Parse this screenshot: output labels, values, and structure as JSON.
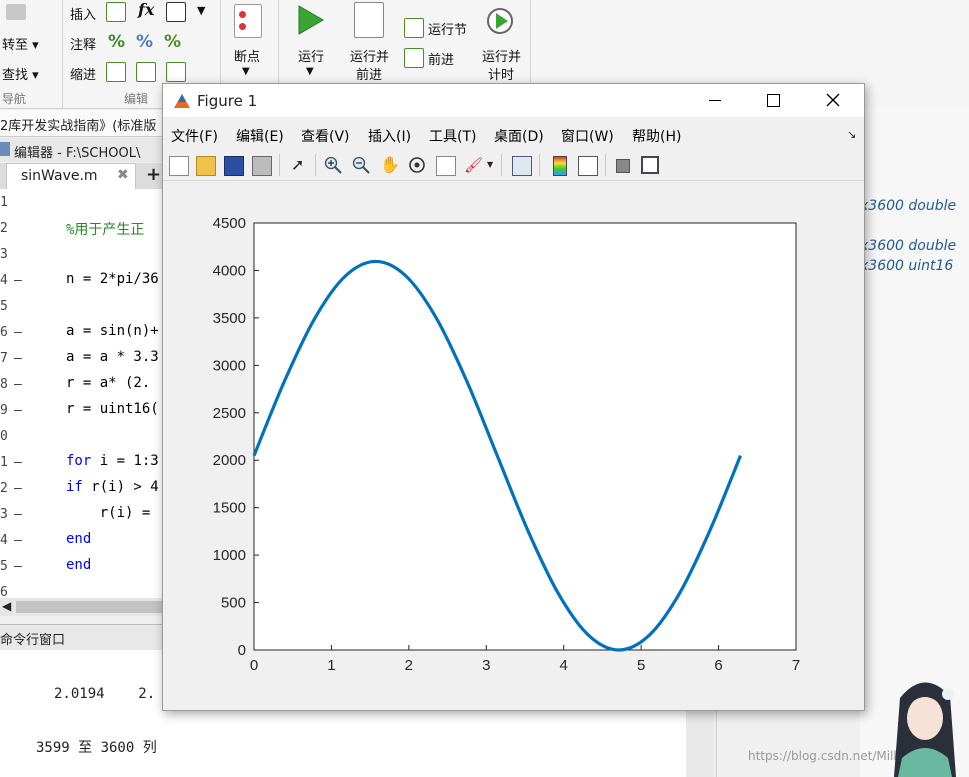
{
  "ribbon": {
    "nav": {
      "goto": "转至",
      "find": "查找",
      "section": "导航"
    },
    "edit": {
      "insert": "插入",
      "comment": "注释",
      "indent": "缩进",
      "section": "编辑"
    },
    "breakpoint": {
      "label": "断点"
    },
    "run": {
      "run": "运行",
      "run_advance_1": "运行并",
      "run_advance_2": "前进",
      "run_section": "运行节",
      "advance": "前进",
      "run_time_1": "运行并",
      "run_time_2": "计时"
    }
  },
  "pathbar": {
    "text": "2库开发实战指南》(标准版"
  },
  "editor": {
    "header": "编辑器 - F:\\SCHOOL\\",
    "tab": "sinWave.m",
    "lines": [
      {
        "n": "1",
        "dash": "",
        "code": "",
        "kind": "plain"
      },
      {
        "n": "2",
        "dash": "",
        "code": "%用于产生正",
        "kind": "comment"
      },
      {
        "n": "3",
        "dash": "",
        "code": "",
        "kind": "plain"
      },
      {
        "n": "4",
        "dash": "—",
        "code": "n = 2*pi/36",
        "kind": "plain"
      },
      {
        "n": "5",
        "dash": "",
        "code": "",
        "kind": "plain"
      },
      {
        "n": "6",
        "dash": "—",
        "code": "a = sin(n)+",
        "kind": "plain"
      },
      {
        "n": "7",
        "dash": "—",
        "code": "a = a * 3.3",
        "kind": "plain"
      },
      {
        "n": "8",
        "dash": "—",
        "code": "r = a* (2.",
        "kind": "plain"
      },
      {
        "n": "9",
        "dash": "—",
        "code": "r = uint16(",
        "kind": "plain"
      },
      {
        "n": "0",
        "dash": "",
        "code": "",
        "kind": "plain"
      },
      {
        "n": "1",
        "dash": "—",
        "kw": "for",
        "code": " i = 1:3",
        "kind": "keyword"
      },
      {
        "n": "2",
        "dash": "—",
        "kw": "if",
        "code": " r(i) > 4",
        "kind": "keyword"
      },
      {
        "n": "3",
        "dash": "—",
        "code": "    r(i) =",
        "kind": "plain"
      },
      {
        "n": "4",
        "dash": "—",
        "kw": "end",
        "code": "",
        "kind": "keyword"
      },
      {
        "n": "5",
        "dash": "—",
        "kw": "end",
        "code": "",
        "kind": "keyword"
      },
      {
        "n": "6",
        "dash": "",
        "code": "",
        "kind": "plain"
      }
    ]
  },
  "command_window": {
    "title": "命令行窗口",
    "line1": "2.0194    2.",
    "line2": "3599 至 3600 列"
  },
  "workspace": {
    "rows": [
      "x3600 double",
      "x3600 double",
      "x3600 uint16"
    ],
    "watermark": "https://blog.csdn.net/Milk_way"
  },
  "figure": {
    "title": "Figure 1",
    "menus": [
      "文件(F)",
      "编辑(E)",
      "查看(V)",
      "插入(I)",
      "工具(T)",
      "桌面(D)",
      "窗口(W)",
      "帮助(H)"
    ],
    "colors": {
      "line": "#0072bd"
    }
  },
  "chart_data": {
    "type": "line",
    "title": "",
    "xlabel": "",
    "ylabel": "",
    "xlim": [
      0,
      7
    ],
    "ylim": [
      0,
      4500
    ],
    "xticks": [
      0,
      1,
      2,
      3,
      4,
      5,
      6,
      7
    ],
    "yticks": [
      0,
      500,
      1000,
      1500,
      2000,
      2500,
      3000,
      3500,
      4000,
      4500
    ],
    "grid": false,
    "series": [
      {
        "x": [
          0,
          0.3927,
          0.7854,
          1.1781,
          1.5708,
          1.9635,
          2.3562,
          2.7489,
          3.1416,
          3.5343,
          3.927,
          4.3197,
          4.7124,
          5.1051,
          5.4978,
          5.8905,
          6.2832
        ],
        "y": [
          2048,
          2832,
          3496,
          3940,
          4095,
          3940,
          3496,
          2832,
          2048,
          1264,
          600,
          156,
          0,
          156,
          600,
          1264,
          2048
        ]
      }
    ]
  }
}
